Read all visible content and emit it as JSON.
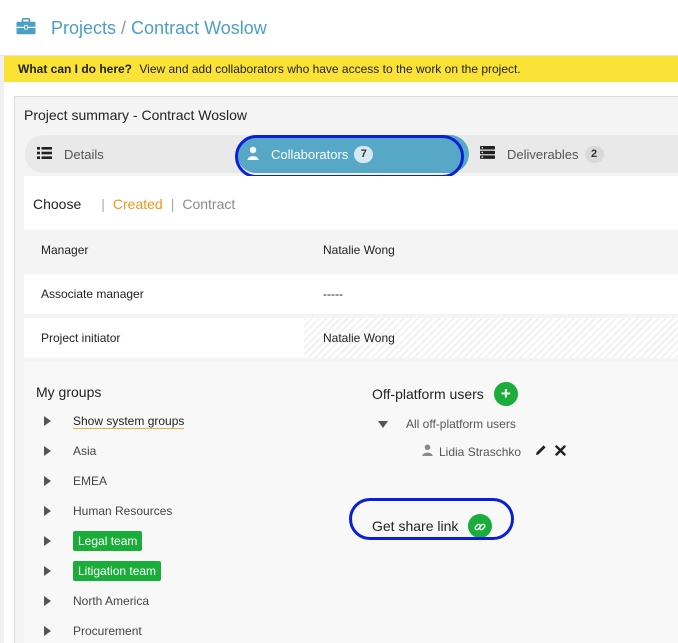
{
  "header": {
    "section": "Projects",
    "separator": "/",
    "project": "Contract Woslow"
  },
  "helpbar": {
    "question": "What can I do here?",
    "text": "View and add collaborators who have access to the work on the project."
  },
  "panel": {
    "title": "Project summary - Contract Woslow",
    "tabs": [
      {
        "label": "Details"
      },
      {
        "label": "Collaborators",
        "count": "7"
      },
      {
        "label": "Deliverables",
        "count": "2"
      }
    ]
  },
  "filter": {
    "label": "Choose",
    "options": [
      "Created",
      "Contract"
    ]
  },
  "roles": [
    {
      "key": "Manager",
      "value": "Natalie Wong"
    },
    {
      "key": "Associate manager",
      "value": "-----"
    },
    {
      "key": "Project initiator",
      "value": "Natalie Wong"
    }
  ],
  "my_groups": {
    "title": "My groups",
    "items": [
      {
        "label": "Show system groups"
      },
      {
        "label": "Asia"
      },
      {
        "label": "EMEA"
      },
      {
        "label": "Human Resources"
      },
      {
        "label": "Legal team"
      },
      {
        "label": "Litigation team"
      },
      {
        "label": "North America"
      },
      {
        "label": "Procurement"
      }
    ]
  },
  "off_platform": {
    "title": "Off-platform users",
    "add_label": "+",
    "all_label": "All off-platform users",
    "users": [
      {
        "name": "Lidia Straschko"
      }
    ]
  },
  "share": {
    "label": "Get share link"
  },
  "colors": {
    "accent_blue": "#4a9fc4",
    "tab_active": "#56a8c6",
    "green": "#1aad3a",
    "orange": "#f0941d",
    "help_yellow": "#fbe237",
    "highlight": "#0b1fd6"
  }
}
